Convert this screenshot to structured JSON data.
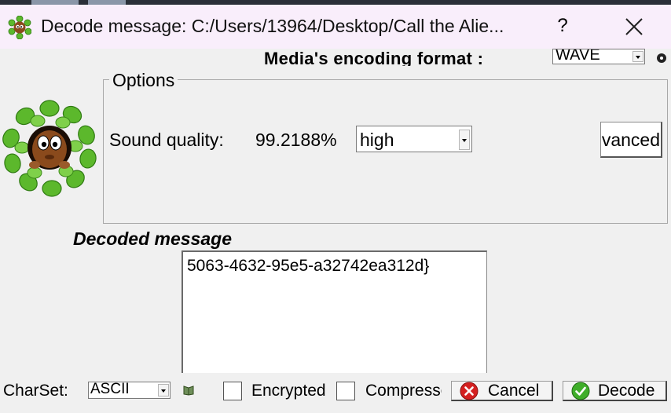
{
  "window": {
    "title": "Decode message: C:/Users/13964/Desktop/Call the Alie...",
    "help_label": "?"
  },
  "icons": {
    "app": "alien-leaf-app-icon",
    "help": "question-mark-icon",
    "close": "close-x-icon",
    "mascot": "alien-in-leaves-mascot",
    "charset_info": "book-icon",
    "cancel": "red-x-circle-icon",
    "decode": "green-check-circle-icon"
  },
  "encoding": {
    "label": "Media's encoding format :",
    "selected": "WAVE"
  },
  "options": {
    "legend": "Options",
    "sound_quality_label": "Sound quality:",
    "sound_quality_value": "99.2188%",
    "quality_selected": "high",
    "advanced_label": "Advanced"
  },
  "decoded": {
    "label": "Decoded message",
    "text": "5063-4632-95e5-a32742ea312d}"
  },
  "bottom": {
    "charset_label": "CharSet:",
    "charset_selected": "ASCII",
    "encrypted_label": "Encrypted",
    "encrypted_checked": false,
    "compressed_label": "Compressed",
    "compressed_checked": false,
    "cancel_label": "Cancel",
    "decode_label": "Decode"
  },
  "colors": {
    "titlebar_bg": "#f9eefb",
    "window_bg": "#f0f0f0",
    "cancel_icon": "#d42020",
    "decode_icon": "#3fae2a",
    "leaf_green": "#5cb82c"
  }
}
